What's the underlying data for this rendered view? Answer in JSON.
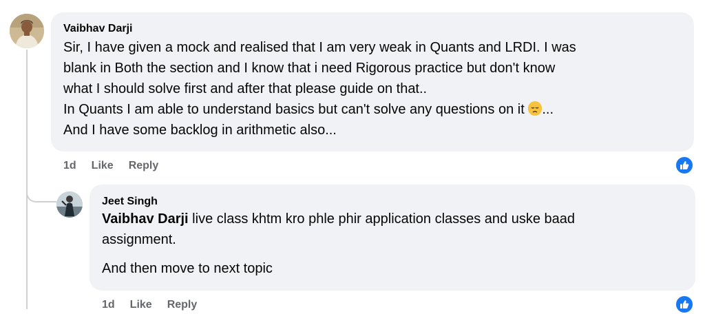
{
  "comment": {
    "author": "Vaibhav Darji",
    "lines": [
      "Sir, I have given a mock and realised that I am very weak in Quants and LRDI. I was",
      "blank in Both the section and I know that i need Rigorous practice but don't know",
      "what I should solve first and after that please guide on that..",
      "In Quants I am able to understand basics but can't solve any questions on it",
      "And I have some backlog in arithmetic also..."
    ],
    "after_emoji": "...",
    "emoji_icon": "disappointed-face-icon",
    "time": "1d",
    "like_label": "Like",
    "reply_label": "Reply"
  },
  "reply": {
    "author": "Jeet Singh",
    "mention": "Vaibhav Darji",
    "line1_rest": " live class khtm kro phle phir application classes and uske baad",
    "line2": "assignment.",
    "paragraph2": "And then move to next topic",
    "time": "1d",
    "like_label": "Like",
    "reply_label": "Reply"
  },
  "colors": {
    "bubble": "#f0f2f5",
    "action_text": "#65676b",
    "like_badge": "#1877f2",
    "thread_line": "#ced0d4"
  }
}
